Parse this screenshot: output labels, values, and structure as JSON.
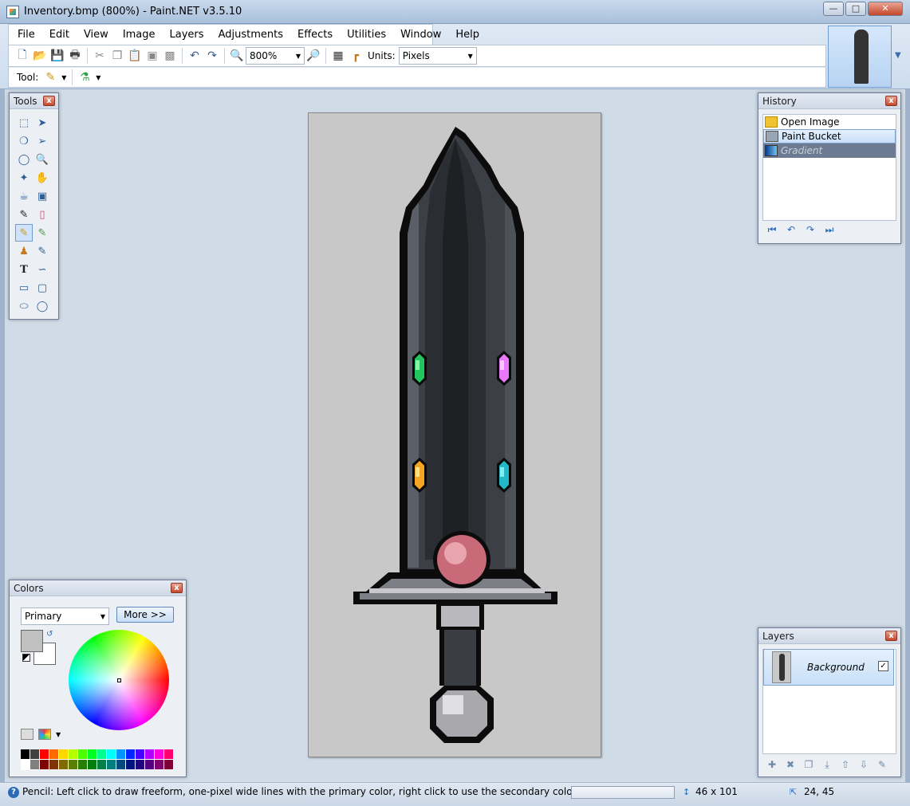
{
  "window": {
    "title": "Inventory.bmp (800%) - Paint.NET v3.5.10"
  },
  "menu": [
    "File",
    "Edit",
    "View",
    "Image",
    "Layers",
    "Adjustments",
    "Effects",
    "Utilities",
    "Window",
    "Help"
  ],
  "toolbar": {
    "zoom": "800%",
    "units_label": "Units:",
    "units": "Pixels",
    "tool_label": "Tool:"
  },
  "tools_panel": {
    "title": "Tools"
  },
  "history_panel": {
    "title": "History",
    "items": [
      {
        "label": "Open Image",
        "state": "normal"
      },
      {
        "label": "Paint Bucket",
        "state": "selected"
      },
      {
        "label": "Gradient",
        "state": "undone"
      }
    ]
  },
  "colors_panel": {
    "title": "Colors",
    "mode": "Primary",
    "more_label": "More >>",
    "primary_color": "#c0c0c0",
    "secondary_color": "#ffffff",
    "palette_top": [
      "#000000",
      "#404040",
      "#ff0000",
      "#ff6a00",
      "#ffd800",
      "#b6ff00",
      "#4cff00",
      "#00ff21",
      "#00ff90",
      "#00ffff",
      "#0094ff",
      "#0026ff",
      "#4800ff",
      "#b200ff",
      "#ff00dc",
      "#ff006e"
    ],
    "palette_bottom": [
      "#ffffff",
      "#808080",
      "#7f0000",
      "#7f3300",
      "#7f6a00",
      "#5b7f00",
      "#267f00",
      "#007f0e",
      "#007f46",
      "#007f7f",
      "#004a7f",
      "#00137f",
      "#21007f",
      "#57007f",
      "#7f006e",
      "#7f0037"
    ]
  },
  "layers_panel": {
    "title": "Layers",
    "layer_name": "Background",
    "visible": true
  },
  "status": {
    "text": "Pencil: Left click to draw freeform, one-pixel wide lines with the primary color, right click to use the secondary color",
    "image_size": "46 x 101",
    "cursor_pos": "24, 45"
  },
  "colors": {
    "accent": "#2a6bb8",
    "canvas_bg": "#c8c8c8",
    "blade_dark": "#2b2f33",
    "gem_green": "#22c55e",
    "gem_pink": "#e879f9",
    "gem_orange": "#f5a524",
    "gem_cyan": "#22b8c5",
    "pommel_red": "#c96a78"
  }
}
